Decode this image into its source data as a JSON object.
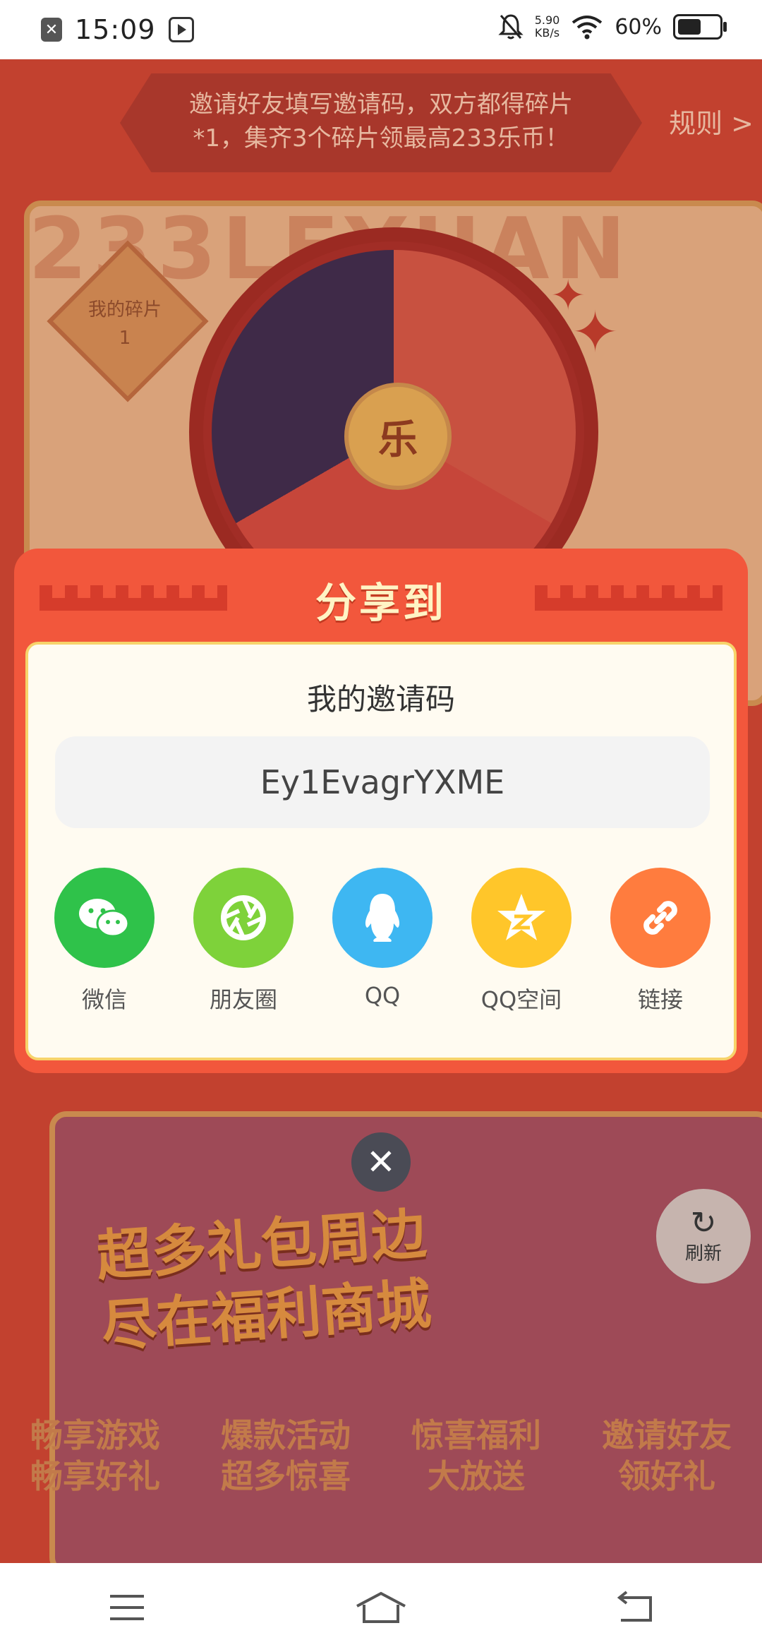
{
  "status_bar": {
    "time": "15:09",
    "net_speed_value": "5.90",
    "net_speed_unit": "KB/s",
    "battery_percent": "60%",
    "battery_level": 0.6,
    "icons": [
      "close-box-icon",
      "play-icon",
      "mute-bell-icon",
      "wifi-icon",
      "battery-icon"
    ]
  },
  "background": {
    "banner_line1": "邀请好友填写邀请码，双方都得碎片",
    "banner_line2": "*1，集齐3个碎片领最高233乐币！",
    "rules_link": "规则 >",
    "watermark": "233LEYUAN",
    "piece_label": "我的碎片",
    "piece_count": "1",
    "wheel_center": "乐",
    "mall_line1": "超多礼包周边",
    "mall_line2": "尽在福利商城",
    "features": [
      {
        "line1": "畅享游戏",
        "line2": "畅享好礼"
      },
      {
        "line1": "爆款活动",
        "line2": "超多惊喜"
      },
      {
        "line1": "惊喜福利",
        "line2": "大放送"
      },
      {
        "line1": "邀请好友",
        "line2": "领好礼"
      }
    ],
    "refresh_label": "刷新"
  },
  "modal": {
    "title": "分享到",
    "invite_label": "我的邀请码",
    "invite_code": "Ey1EvagrYXME",
    "share_options": [
      {
        "label": "微信",
        "icon": "wechat-icon",
        "color": "#2fc24a"
      },
      {
        "label": "朋友圈",
        "icon": "moments-icon",
        "color": "#7ed23a"
      },
      {
        "label": "QQ",
        "icon": "qq-icon",
        "color": "#3eb7f2"
      },
      {
        "label": "QQ空间",
        "icon": "qzone-icon",
        "color": "#ffc62a"
      },
      {
        "label": "链接",
        "icon": "link-icon",
        "color": "#ff7c3e"
      }
    ]
  },
  "colors": {
    "modal_red": "#f2573c",
    "panel_cream": "#fffbf1",
    "title_gold": "#fff3c4"
  }
}
